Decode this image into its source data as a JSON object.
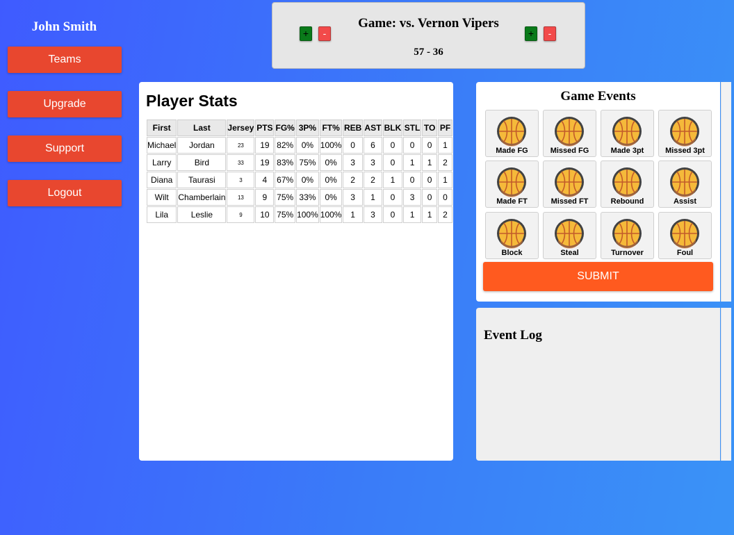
{
  "sidebar": {
    "user_name": "John Smith",
    "items": [
      {
        "label": "Teams"
      },
      {
        "label": "Upgrade"
      },
      {
        "label": "Support"
      },
      {
        "label": "Logout"
      }
    ]
  },
  "scoreboard": {
    "title": "Game: vs. Vernon Vipers",
    "score": "57 - 36",
    "plus_label": "+",
    "minus_label": "-"
  },
  "player_stats": {
    "title": "Player Stats",
    "columns": [
      "First",
      "Last",
      "Jersey",
      "PTS",
      "FG%",
      "3P%",
      "FT%",
      "REB",
      "AST",
      "BLK",
      "STL",
      "TO",
      "PF"
    ],
    "rows": [
      [
        "Michael",
        "Jordan",
        "23",
        "19",
        "82%",
        "0%",
        "100%",
        "0",
        "6",
        "0",
        "0",
        "0",
        "1"
      ],
      [
        "Larry",
        "Bird",
        "33",
        "19",
        "83%",
        "75%",
        "0%",
        "3",
        "3",
        "0",
        "1",
        "1",
        "2"
      ],
      [
        "Diana",
        "Taurasi",
        "3",
        "4",
        "67%",
        "0%",
        "0%",
        "2",
        "2",
        "1",
        "0",
        "0",
        "1"
      ],
      [
        "Wilt",
        "Chamberlain",
        "13",
        "9",
        "75%",
        "33%",
        "0%",
        "3",
        "1",
        "0",
        "3",
        "0",
        "0"
      ],
      [
        "Lila",
        "Leslie",
        "9",
        "10",
        "75%",
        "100%",
        "100%",
        "1",
        "3",
        "0",
        "1",
        "1",
        "2"
      ]
    ]
  },
  "game_events": {
    "title": "Game Events",
    "icon": "basketball-icon",
    "events": [
      "Made FG",
      "Missed FG",
      "Made 3pt",
      "Missed 3pt",
      "Made FT",
      "Missed FT",
      "Rebound",
      "Assist",
      "Block",
      "Steal",
      "Turnover",
      "Foul"
    ],
    "submit_label": "SUBMIT"
  },
  "event_log": {
    "title": "Event Log"
  },
  "colors": {
    "nav_button": "#e8472f",
    "submit_button": "#ff5a1f",
    "plus_button": "#0a7a1a",
    "minus_button": "#f24a4a"
  }
}
